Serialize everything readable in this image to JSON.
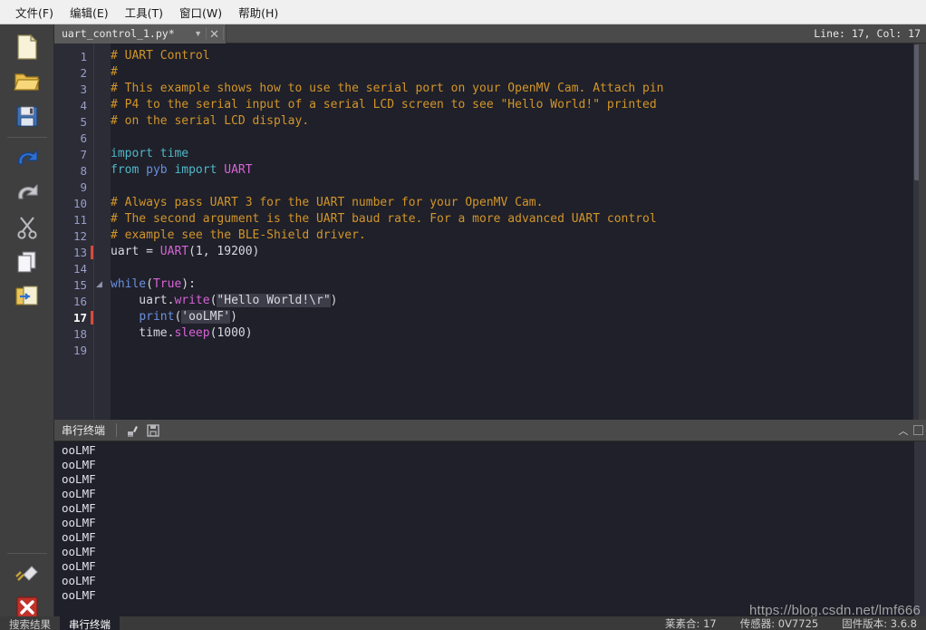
{
  "menu": {
    "items": [
      {
        "label": "文件(F)",
        "mnemonic": "F"
      },
      {
        "label": "编辑(E)",
        "mnemonic": "E"
      },
      {
        "label": "工具(T)",
        "mnemonic": "T"
      },
      {
        "label": "窗口(W)",
        "mnemonic": "W"
      },
      {
        "label": "帮助(H)",
        "mnemonic": "H"
      }
    ]
  },
  "toolbar": {
    "icons": [
      {
        "name": "new-file-icon",
        "title": "新建"
      },
      {
        "name": "open-folder-icon",
        "title": "打开"
      },
      {
        "name": "save-icon",
        "title": "保存"
      },
      {
        "name": "undo-icon",
        "title": "撤销"
      },
      {
        "name": "redo-icon",
        "title": "重做"
      },
      {
        "name": "cut-icon",
        "title": "剪切"
      },
      {
        "name": "copy-icon",
        "title": "复制"
      },
      {
        "name": "paste-icon",
        "title": "粘贴"
      },
      {
        "name": "connect-plug-icon",
        "title": "连接"
      },
      {
        "name": "stop-icon",
        "title": "停止"
      }
    ]
  },
  "tab": {
    "filename": "uart_control_1.py*",
    "caret_glyph": "▼",
    "close_glyph": "✕",
    "linecol": "Line: 17, Col: 17"
  },
  "editor": {
    "total_lines": 19,
    "current_line": 17,
    "modified_lines": [
      13,
      17
    ],
    "fold_line": 15,
    "lines": [
      {
        "n": 1,
        "segs": [
          {
            "t": "# UART Control",
            "c": "cm"
          }
        ]
      },
      {
        "n": 2,
        "segs": [
          {
            "t": "#",
            "c": "cm"
          }
        ]
      },
      {
        "n": 3,
        "segs": [
          {
            "t": "# This example shows how to use the serial port on your OpenMV Cam. Attach pin",
            "c": "cm"
          }
        ]
      },
      {
        "n": 4,
        "segs": [
          {
            "t": "# P4 to the serial input of a serial LCD screen to see \"Hello World!\" printed",
            "c": "cm"
          }
        ]
      },
      {
        "n": 5,
        "segs": [
          {
            "t": "# on the serial LCD display.",
            "c": "cm"
          }
        ]
      },
      {
        "n": 6,
        "segs": []
      },
      {
        "n": 7,
        "segs": [
          {
            "t": "import",
            "c": "kw"
          },
          {
            "t": " ",
            "c": "pl"
          },
          {
            "t": "time",
            "c": "kw"
          }
        ]
      },
      {
        "n": 8,
        "segs": [
          {
            "t": "from",
            "c": "kw"
          },
          {
            "t": " ",
            "c": "pl"
          },
          {
            "t": "pyb",
            "c": "kw2"
          },
          {
            "t": " ",
            "c": "pl"
          },
          {
            "t": "import",
            "c": "kw"
          },
          {
            "t": " ",
            "c": "pl"
          },
          {
            "t": "UART",
            "c": "cls"
          }
        ]
      },
      {
        "n": 9,
        "segs": []
      },
      {
        "n": 10,
        "segs": [
          {
            "t": "# Always pass UART 3 for the UART number for your OpenMV Cam.",
            "c": "cm"
          }
        ]
      },
      {
        "n": 11,
        "segs": [
          {
            "t": "# The second argument is the UART baud rate. For a more advanced UART control",
            "c": "cm"
          }
        ]
      },
      {
        "n": 12,
        "segs": [
          {
            "t": "# example see the BLE-Shield driver.",
            "c": "cm"
          }
        ]
      },
      {
        "n": 13,
        "segs": [
          {
            "t": "uart = ",
            "c": "pl"
          },
          {
            "t": "UART",
            "c": "cls"
          },
          {
            "t": "(1, 19200)",
            "c": "pl"
          }
        ]
      },
      {
        "n": 14,
        "segs": []
      },
      {
        "n": 15,
        "segs": [
          {
            "t": "while",
            "c": "kw2"
          },
          {
            "t": "(",
            "c": "pl"
          },
          {
            "t": "True",
            "c": "cls"
          },
          {
            "t": "):",
            "c": "pl"
          }
        ]
      },
      {
        "n": 16,
        "segs": [
          {
            "t": "    uart.",
            "c": "pl"
          },
          {
            "t": "write",
            "c": "fn"
          },
          {
            "t": "(",
            "c": "pl"
          },
          {
            "t": "\"Hello World!\\r\"",
            "c": "str"
          },
          {
            "t": ")",
            "c": "pl"
          }
        ]
      },
      {
        "n": 17,
        "segs": [
          {
            "t": "    ",
            "c": "pl"
          },
          {
            "t": "print",
            "c": "kw2"
          },
          {
            "t": "(",
            "c": "pl"
          },
          {
            "t": "'ooLMF",
            "c": "str"
          },
          {
            "t": "|CARET|",
            "c": "caret"
          },
          {
            "t": "'",
            "c": "str"
          },
          {
            "t": ")",
            "c": "pl"
          }
        ]
      },
      {
        "n": 18,
        "segs": [
          {
            "t": "    time.",
            "c": "pl"
          },
          {
            "t": "sleep",
            "c": "fn"
          },
          {
            "t": "(1000)",
            "c": "pl"
          }
        ]
      },
      {
        "n": 19,
        "segs": []
      }
    ]
  },
  "terminal": {
    "title": "串行终端",
    "icons": [
      {
        "name": "clear-terminal-icon",
        "title": "清除"
      },
      {
        "name": "save-terminal-icon",
        "title": "保存"
      }
    ],
    "collapse_glyph": "︿",
    "lines": [
      "ooLMF",
      "ooLMF",
      "ooLMF",
      "ooLMF",
      "ooLMF",
      "ooLMF",
      "ooLMF",
      "ooLMF",
      "ooLMF",
      "ooLMF",
      "ooLMF"
    ]
  },
  "watermark": "https://blog.csdn.net/lmf666",
  "statusbar": {
    "tabs": [
      {
        "label": "搜索结果",
        "active": false
      },
      {
        "label": "串行终端",
        "active": true
      }
    ],
    "info": [
      "莱素合: 17",
      "传感器: 0V7725",
      "固件版本: 3.6.8"
    ]
  },
  "colors": {
    "editor_bg": "#1f2029",
    "gutter_bg": "#2b2c36",
    "comment": "#d2952a",
    "keyword": "#4fb8c9",
    "keyword2": "#6a8fe0",
    "class": "#d763d7",
    "plain": "#d8d8e0",
    "chrome": "#3f3f3f",
    "menubar": "#f0f0f0",
    "modified_marker": "#d94a3d"
  }
}
